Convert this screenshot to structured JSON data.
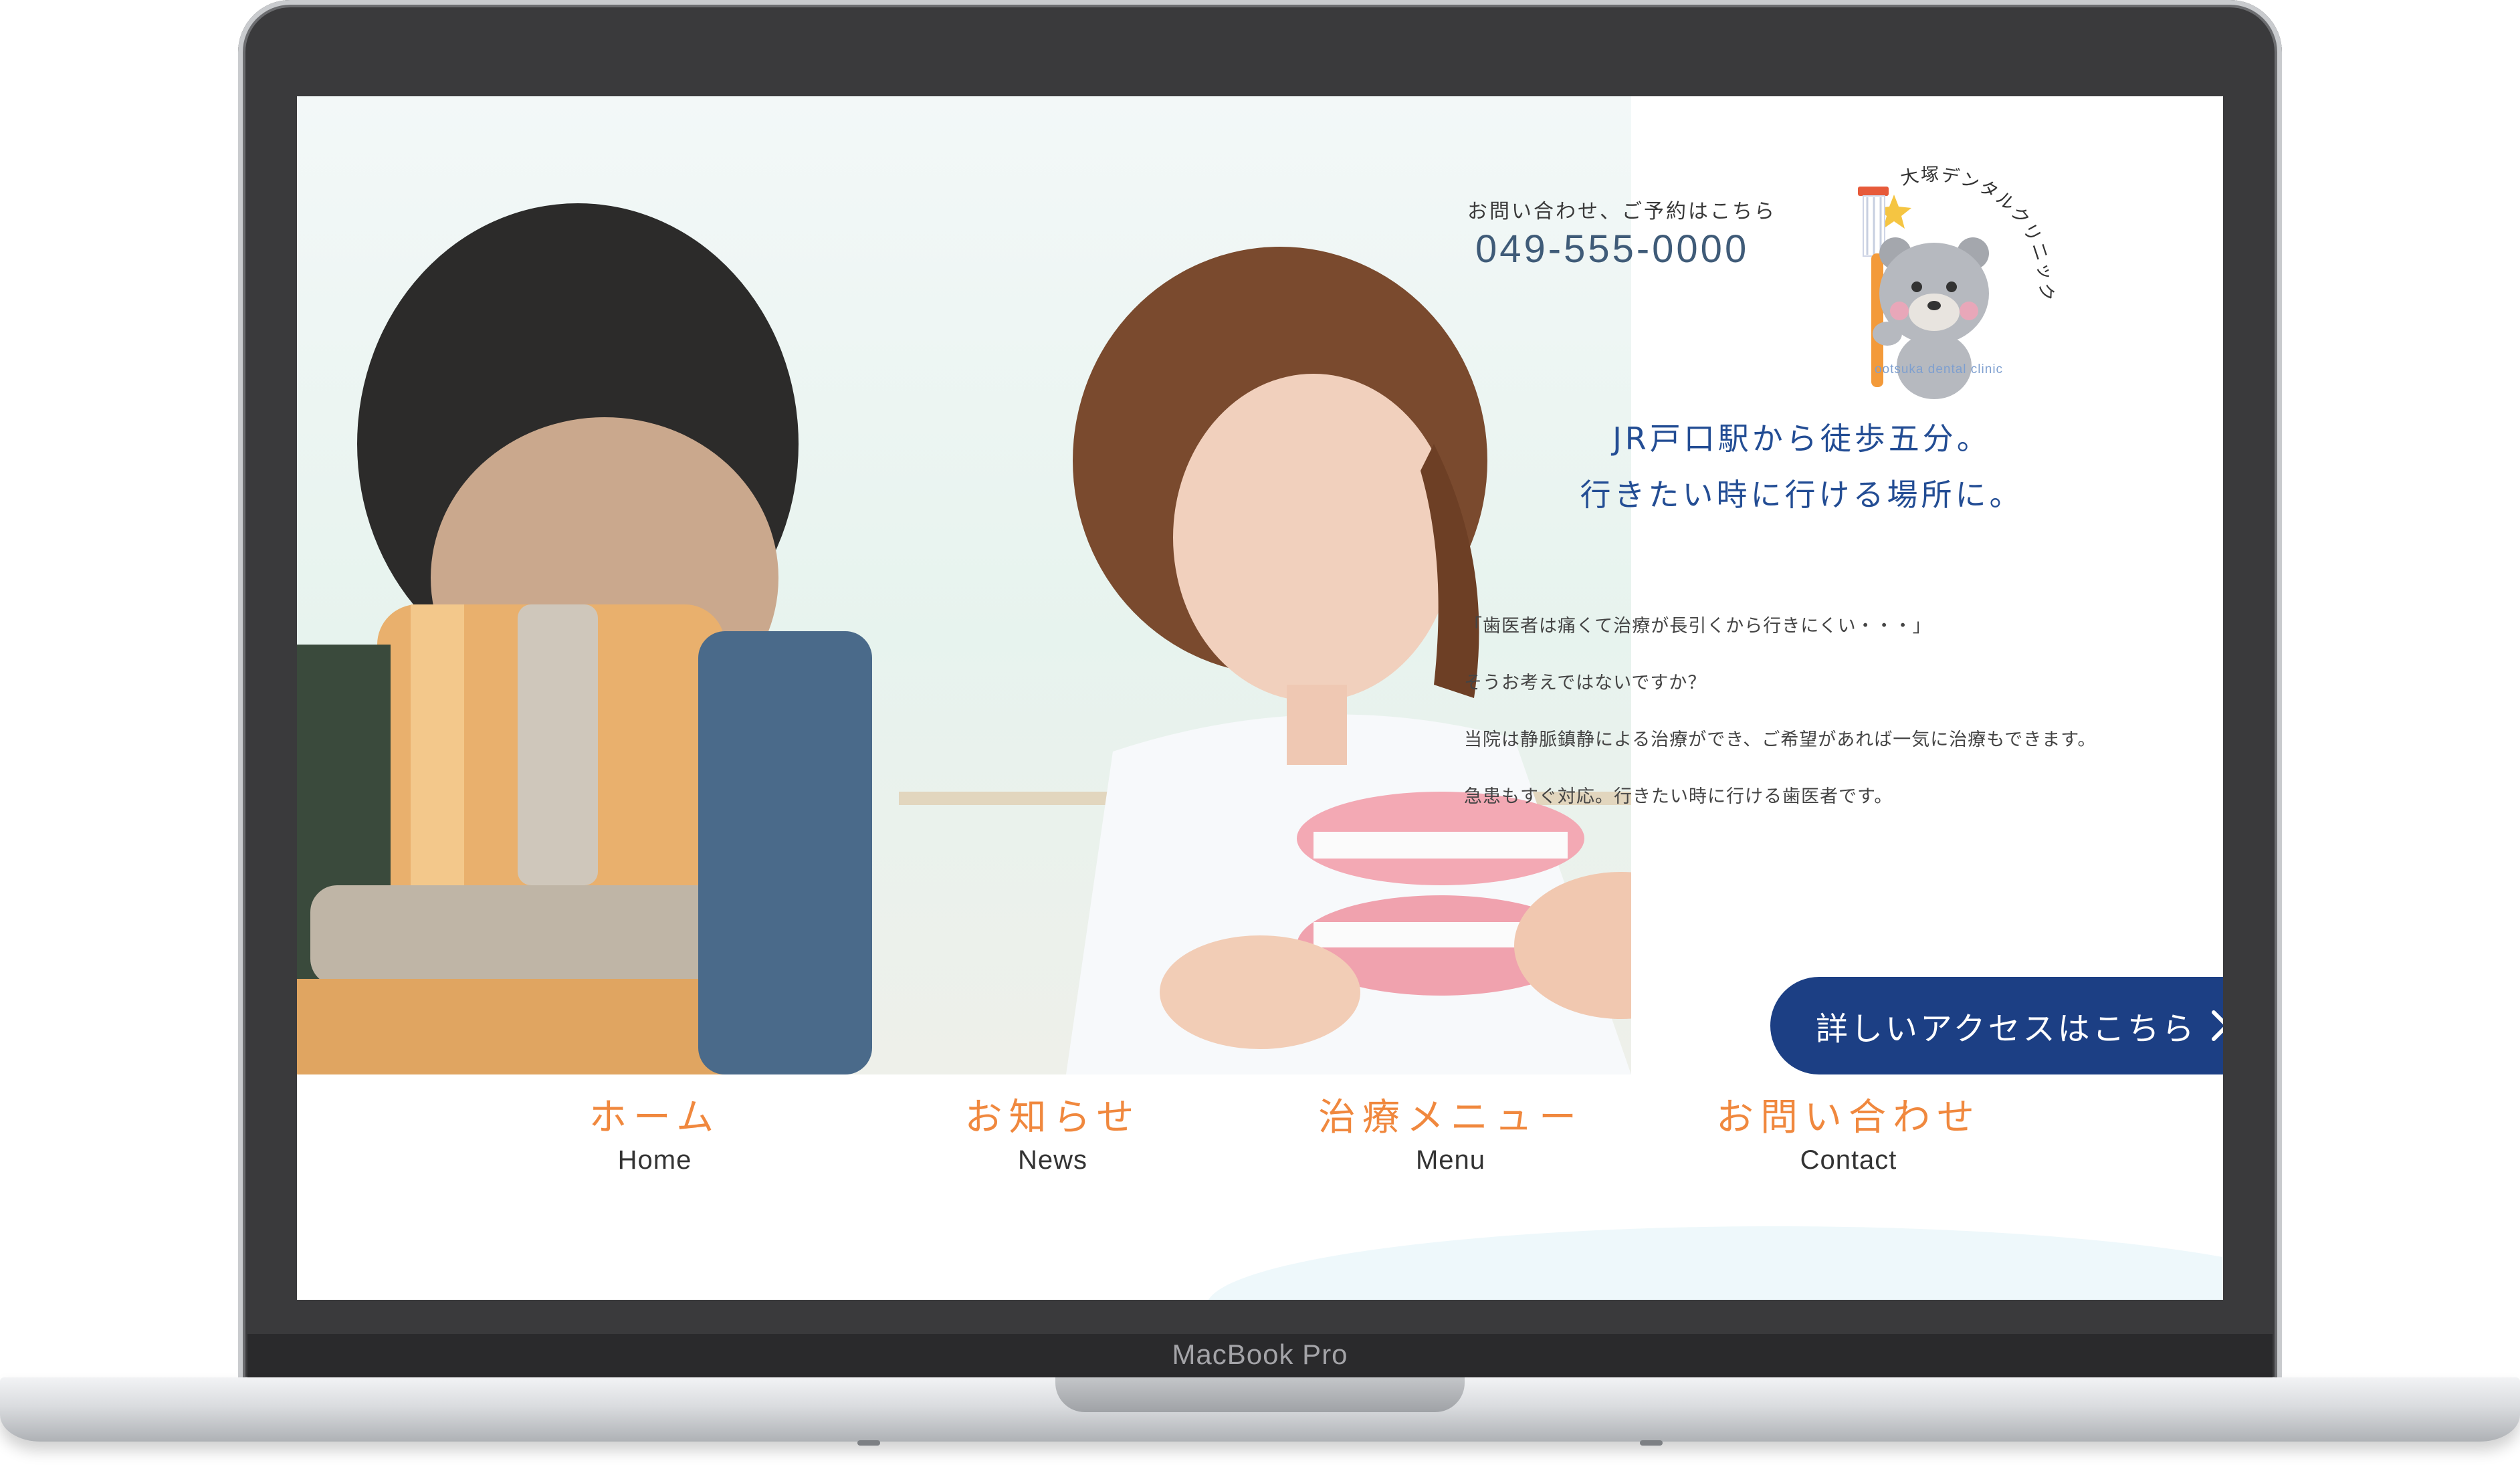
{
  "device": {
    "model_label": "MacBook Pro"
  },
  "contact": {
    "label": "お問い合わせ、ご予約はこちら",
    "phone": "049-555-0000"
  },
  "logo": {
    "name": "大塚デンタルクリニック",
    "subtitle": "ootsuka dental clinic",
    "icon": "bear-with-toothbrush-icon"
  },
  "hero": {
    "tagline": [
      "JR戸口駅から徒歩五分。",
      "行きたい時に行ける場所に。"
    ],
    "image": "dentist-with-tooth-model-photo"
  },
  "intro": {
    "lines": [
      "「歯医者は痛くて治療が長引くから行きにくい・・・」",
      "そうお考えではないですか？",
      "当院は静脈鎮静による治療ができ、ご希望があれば一気に治療もできます。",
      "急患もすぐ対応。行きたい時に行ける歯医者です。"
    ]
  },
  "access_button": {
    "label": "詳しいアクセスはこちら",
    "icon": "chevron-right-icon"
  },
  "nav": {
    "items": [
      {
        "jp": "ホーム",
        "en": "Home"
      },
      {
        "jp": "お知らせ",
        "en": "News"
      },
      {
        "jp": "治療メニュー",
        "en": "Menu"
      },
      {
        "jp": "お問い合わせ",
        "en": "Contact"
      }
    ]
  },
  "colors": {
    "accent_orange": "#f0883e",
    "brand_navy": "#1c3f84",
    "tagline_blue": "#234d94",
    "phone_blue": "#3f5b78"
  }
}
